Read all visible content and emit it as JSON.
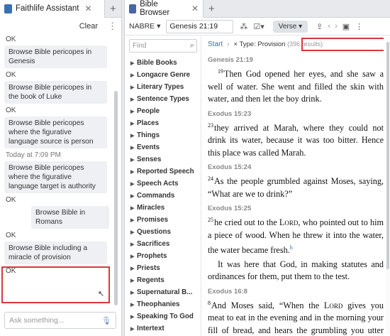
{
  "assistant": {
    "tab_title": "Faithlife Assistant",
    "clear_label": "Clear",
    "input_placeholder": "Ask something...",
    "time_separator": "Today at 7:09 PM",
    "items": [
      {
        "kind": "ok",
        "text": "OK"
      },
      {
        "kind": "request",
        "text": "Browse Bible pericopes in Genesis"
      },
      {
        "kind": "ok",
        "text": "OK"
      },
      {
        "kind": "request",
        "text": "Browse Bible pericopes in the book of Luke"
      },
      {
        "kind": "ok",
        "text": "OK"
      },
      {
        "kind": "request",
        "text": "Browse Bible pericopes where the figurative language source is person"
      },
      {
        "kind": "separator",
        "text": "Today at 7:09 PM"
      },
      {
        "kind": "request",
        "text": "Browse Bible pericopes where the figurative language target is authority"
      },
      {
        "kind": "ok",
        "text": "OK"
      },
      {
        "kind": "request-right",
        "text": "Browse Bible in Romans"
      },
      {
        "kind": "ok",
        "text": "OK"
      },
      {
        "kind": "request",
        "text": "Browse Bible including a miracle of provision"
      },
      {
        "kind": "ok",
        "text": "OK"
      }
    ]
  },
  "browser": {
    "tab_title": "Bible Browser",
    "version": "NABRE",
    "reference": "Genesis 21:19",
    "view_mode": "Verse",
    "find_placeholder": "Find",
    "facets": [
      "Bible Books",
      "Longacre Genre",
      "Literary Types",
      "Sentence Types",
      "People",
      "Places",
      "Things",
      "Events",
      "Senses",
      "Reported Speech",
      "Speech Acts",
      "Commands",
      "Miracles",
      "Promises",
      "Questions",
      "Sacrifices",
      "Prophets",
      "Priests",
      "Regents",
      "Supernatural B...",
      "Theophanies",
      "Speaking To God",
      "Intertext"
    ],
    "breadcrumb_start": "Start",
    "filter_label": "× Type: Provision",
    "results_count": "(396 results)",
    "verses": [
      {
        "ref": "Genesis 21:19",
        "num": "19",
        "text": "Then God opened her eyes, and she saw a well of water. She went and filled the skin with water, and then let the boy drink."
      },
      {
        "ref": "Exodus 15:23",
        "num": "23",
        "text": "they arrived at Marah, where they could not drink its water, because it was too bitter. Hence this place was called Marah."
      },
      {
        "ref": "Exodus 15:24",
        "num": "24",
        "text": "As the people grumbled against Moses, saying, “What are we to drink?”"
      },
      {
        "ref": "Exodus 15:25",
        "num": "25",
        "text_a": "he cried out to the ",
        "lord": "Lord",
        "text_b": ", who pointed out to him a piece of wood. When he threw it into the water, the water became fresh.",
        "footnote": "h",
        "para2": "It was here that God, in making statutes and ordinances for them, put them to the test."
      },
      {
        "ref": "Exodus 16:8",
        "num": "8",
        "text_a": "And Moses said, “When the ",
        "lord": "Lord",
        "text_b": " gives you meat to eat in the evening and in the morning your fill of bread, and hears the grumbling you utter against him, who then are we? Your"
      }
    ]
  },
  "colors": {
    "highlight": "#d6383f",
    "link": "#3a6fb4"
  }
}
